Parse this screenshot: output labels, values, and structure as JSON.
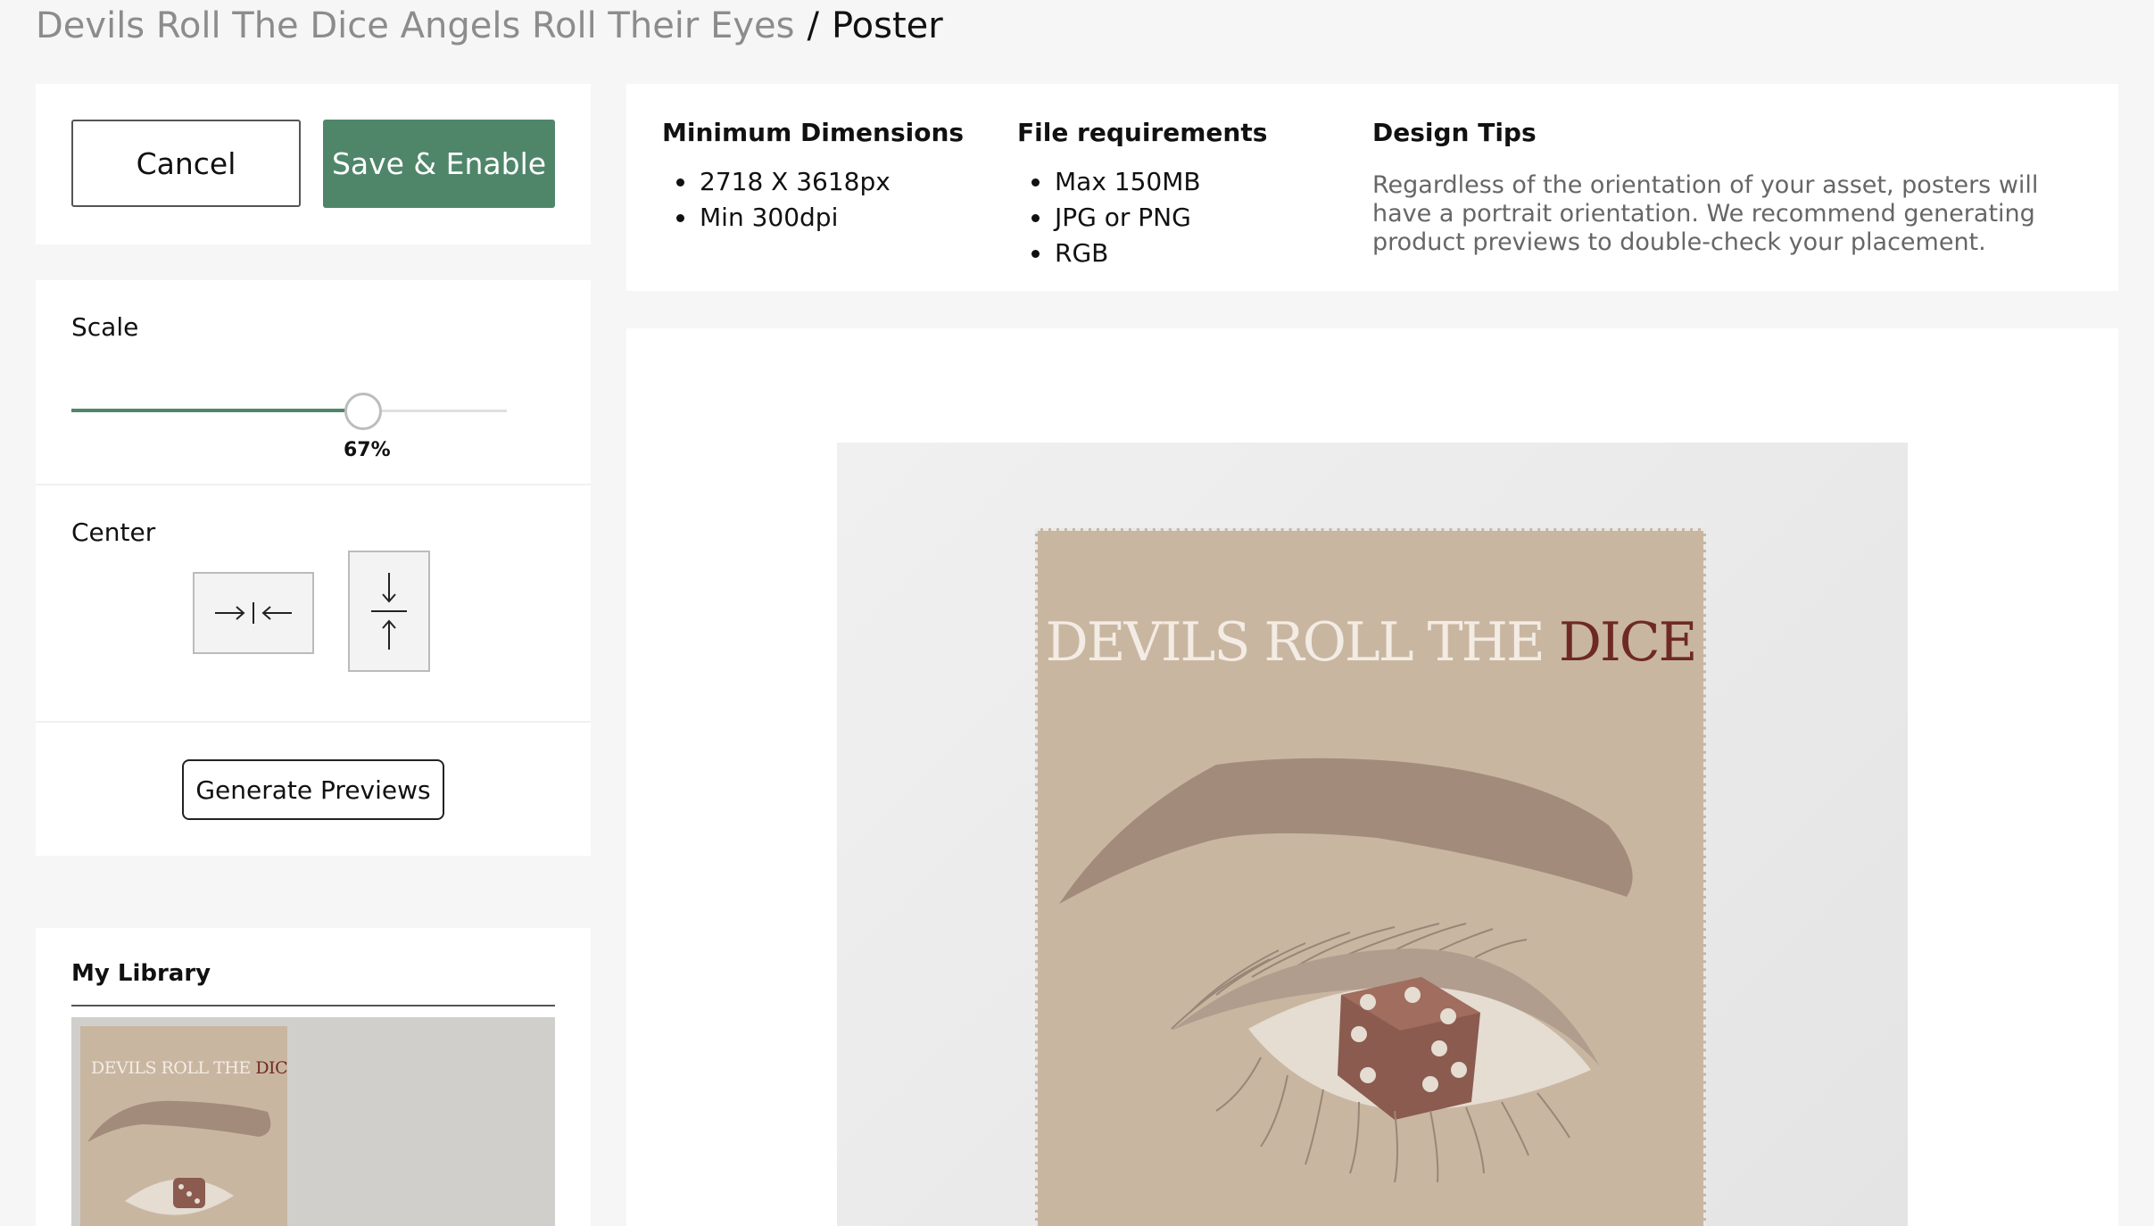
{
  "breadcrumb": {
    "parent": "Devils Roll The Dice Angels Roll Their Eyes",
    "separator": "/",
    "current": "Poster"
  },
  "actions": {
    "cancel_label": "Cancel",
    "save_label": "Save & Enable"
  },
  "scale": {
    "label": "Scale",
    "value": 67,
    "value_text": "67%"
  },
  "center": {
    "label": "Center",
    "horizontal_icon": "center-horizontal-icon",
    "vertical_icon": "center-vertical-icon"
  },
  "generate_label": "Generate Previews",
  "library": {
    "title": "My Library",
    "thumb_title_a": "DEVILS ROLL THE",
    "thumb_title_b": "DICE"
  },
  "requirements": {
    "dimensions": {
      "title": "Minimum Dimensions",
      "items": [
        "2718 X 3618px",
        "Min 300dpi"
      ]
    },
    "file": {
      "title": "File requirements",
      "items": [
        "Max 150MB",
        "JPG or PNG",
        "RGB"
      ]
    },
    "tips": {
      "title": "Design Tips",
      "text": "Regardless of the orientation of your asset, posters will have a portrait orientation. We recommend generating product previews to double-check your placement."
    }
  },
  "poster": {
    "title_a": "DEVILS ROLL THE",
    "title_b": "DICE"
  },
  "colors": {
    "accent": "#4f866a",
    "poster_bg": "#c9b6a1",
    "dice": "#8a5b4e",
    "title_dark": "#6e2a22"
  }
}
